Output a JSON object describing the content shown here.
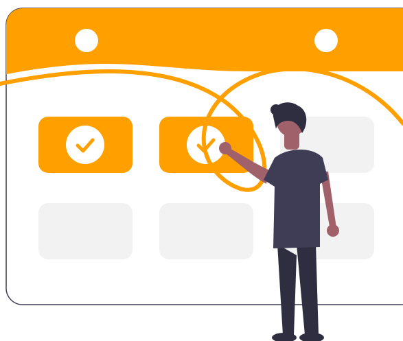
{
  "illustration": {
    "icons": {
      "calendar": "calendar-icon",
      "checkmark": "checkmark-icon",
      "person": "person-figure"
    },
    "calendar": {
      "rows": 2,
      "columns": 3,
      "checked_slots": [
        0,
        1
      ]
    },
    "colors": {
      "accent": "#FF9F00",
      "outline": "#3F3D56",
      "slot_empty": "#F2F2F2",
      "check_circle": "#FFFFFF",
      "skin": "#A0616A",
      "hair": "#2F2E41",
      "shirt": "#3F3D56",
      "pants": "#2F2E41"
    }
  }
}
